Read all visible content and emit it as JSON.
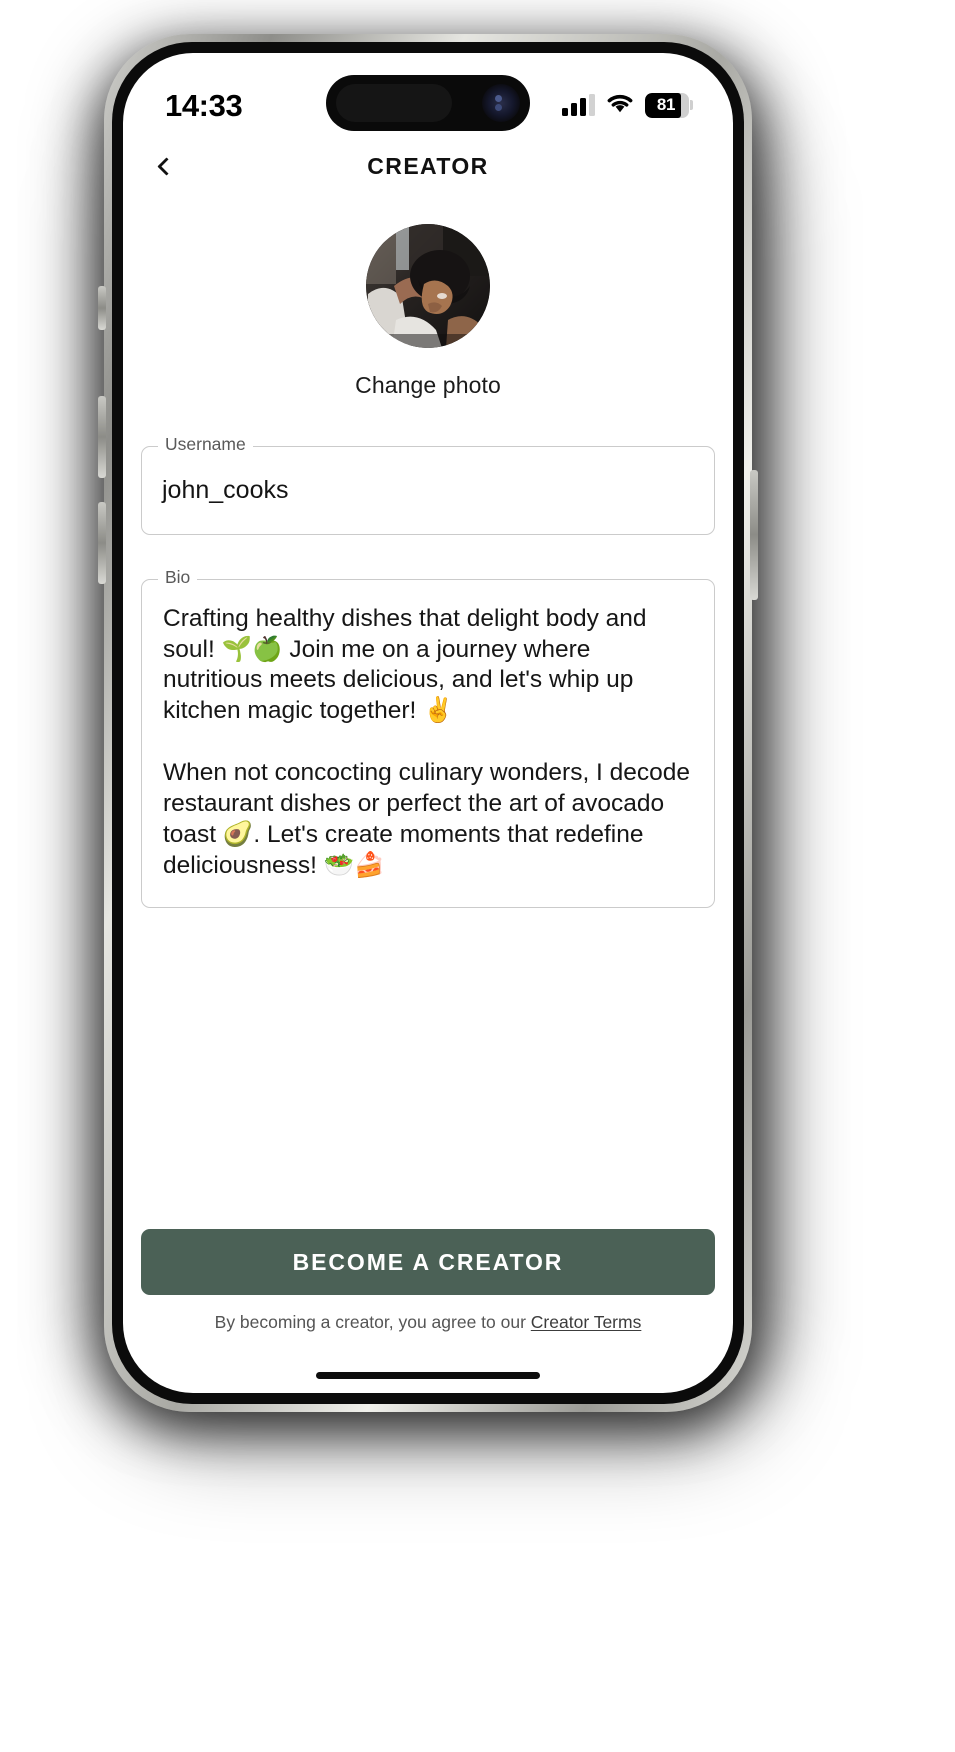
{
  "status_bar": {
    "time": "14:33",
    "cellular_icon": "cellular-bars-icon",
    "wifi_icon": "wifi-icon",
    "battery_icon": "battery-icon",
    "battery_percent": "81",
    "battery_level": 81
  },
  "nav": {
    "back_icon": "back-chevron-icon",
    "title": "CREATOR"
  },
  "profile": {
    "avatar_alt": "avatar",
    "change_photo_label": "Change photo"
  },
  "form": {
    "username": {
      "label": "Username",
      "value": "john_cooks",
      "placeholder": "Username"
    },
    "bio": {
      "label": "Bio",
      "value": "Crafting healthy dishes that delight body and soul! 🌱🍏 Join me on a journey where nutritious meets delicious, and let's whip up kitchen magic together! ✌️\n\nWhen not concocting culinary wonders, I decode restaurant dishes or perfect the art of avocado toast 🥑. Let's create moments that redefine deliciousness! 🥗🍰",
      "placeholder": "Bio"
    }
  },
  "cta": {
    "button_label": "BECOME A CREATOR",
    "button_color": "#4b6156",
    "terms_prefix": "By becoming a creator, you agree to our ",
    "terms_link": "Creator Terms"
  }
}
